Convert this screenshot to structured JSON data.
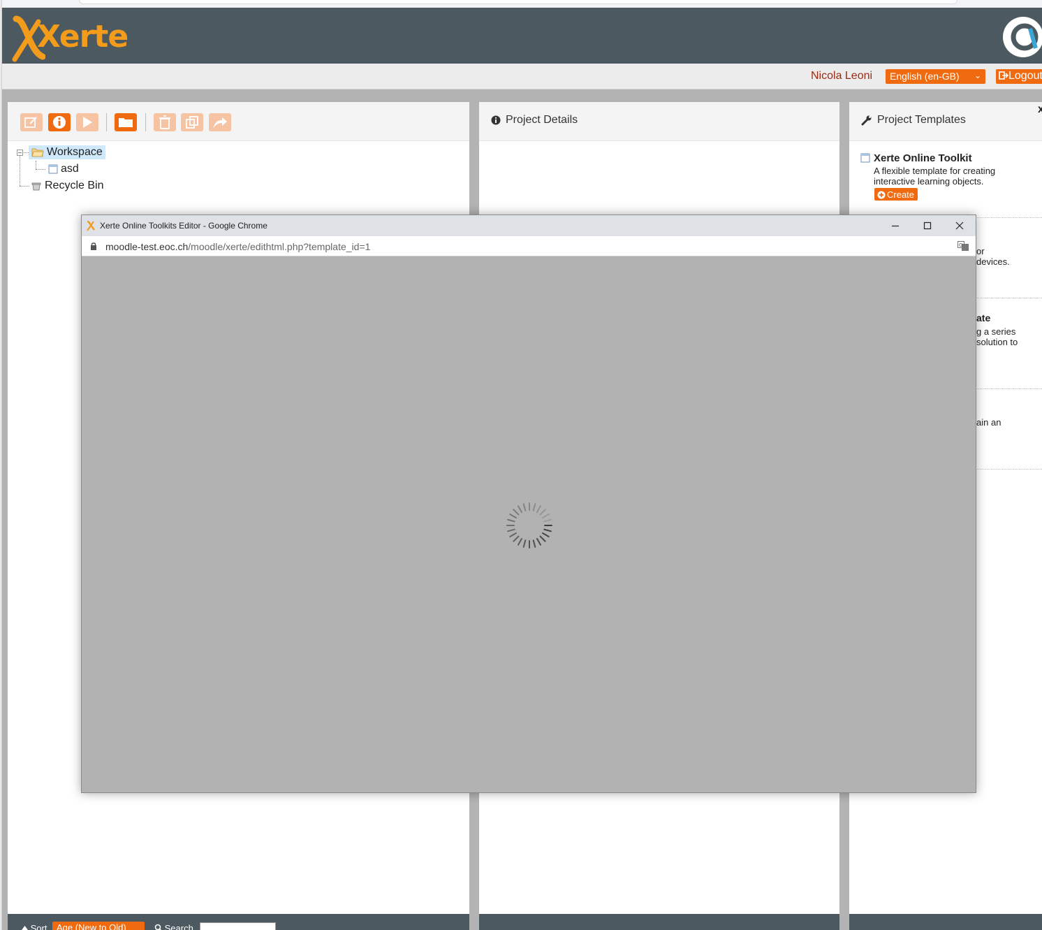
{
  "header": {
    "logo_text": "Xerte"
  },
  "user_bar": {
    "user_name": "Nicola Leoni",
    "language": "English (en-GB)",
    "logout_label": "Logout"
  },
  "workspace": {
    "tree": {
      "root": "Workspace",
      "child": "asd",
      "recycle": "Recycle Bin"
    },
    "toolbar_icons": [
      "edit-icon",
      "info-icon",
      "play-icon",
      "new-folder-icon",
      "delete-icon",
      "duplicate-icon",
      "share-icon"
    ]
  },
  "details": {
    "title": "Project Details"
  },
  "templates": {
    "title": "Project Templates",
    "close_glyph": "x",
    "items": [
      {
        "title": "Xerte Online Toolkit",
        "description": "A flexible template for creating interactive learning objects.",
        "create_label": "Create"
      }
    ],
    "fragments": {
      "f1": "or",
      "f2": "devices.",
      "f3": "ate",
      "f4": "g a series",
      "f5": "solution to",
      "f6": "ain an"
    }
  },
  "bottom": {
    "sort_label": "Sort",
    "sort_value": "Age (New to Old)",
    "search_label": "Search"
  },
  "popup": {
    "title": "Xerte Online Toolkits Editor - Google Chrome",
    "url_host": "moodle-test.eoc.ch",
    "url_path": "/moodle/xerte/edithtml.php?template_id=1"
  },
  "colors": {
    "accent": "#f06a10",
    "header_bg": "#4c5960",
    "logo": "#f39c1b"
  }
}
